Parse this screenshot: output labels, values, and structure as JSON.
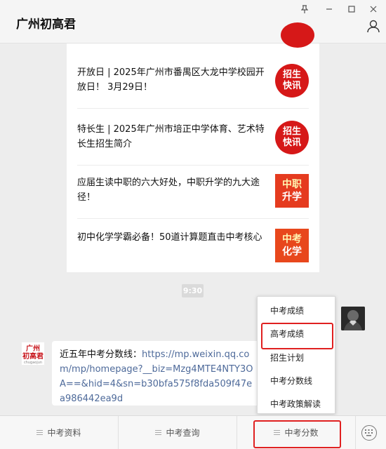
{
  "app": {
    "title": "广州初高君"
  },
  "articles": [
    {
      "title": "开放日 | 2025年广州市番禺区大龙中学校园开放日！ 3月29日！",
      "thumb_line1": "招生",
      "thumb_line2": "快讯"
    },
    {
      "title": "特长生 | 2025年广州市培正中学体育、艺术特长生招生简介",
      "thumb_line1": "招生",
      "thumb_line2": "快讯"
    },
    {
      "title": "应届生读中职的六大好处，中职升学的九大途径！",
      "thumb_line1": "中职",
      "thumb_line2": "升学"
    },
    {
      "title": "初中化学学霸必备！50道计算题直击中考核心",
      "thumb_line1": "中考",
      "thumb_line2": "化学"
    }
  ],
  "chat": {
    "time": "9:30",
    "message_prefix": "近五年中考分数线：",
    "message_link": "https://mp.weixin.qq.com/mp/homepage?__biz=Mzg4MTE4NTY3OA==&hid=4&sn=b30bfa575f8fda509f47ea986442ea9d",
    "avatar_text_line1": "广州",
    "avatar_text_line2": "初高君",
    "avatar_subtext": "chugaojun"
  },
  "popup_menu": {
    "items": [
      "中考成绩",
      "高考成绩",
      "招生计划",
      "中考分数线",
      "中考政策解读"
    ],
    "highlighted_index": 1
  },
  "bottom_tabs": [
    {
      "label": "中考资料"
    },
    {
      "label": "中考查询"
    },
    {
      "label": "中考分数",
      "active": true
    }
  ],
  "colors": {
    "highlight": "#e02020",
    "link": "#4e6a9a",
    "thumb_red": "#d61818"
  }
}
